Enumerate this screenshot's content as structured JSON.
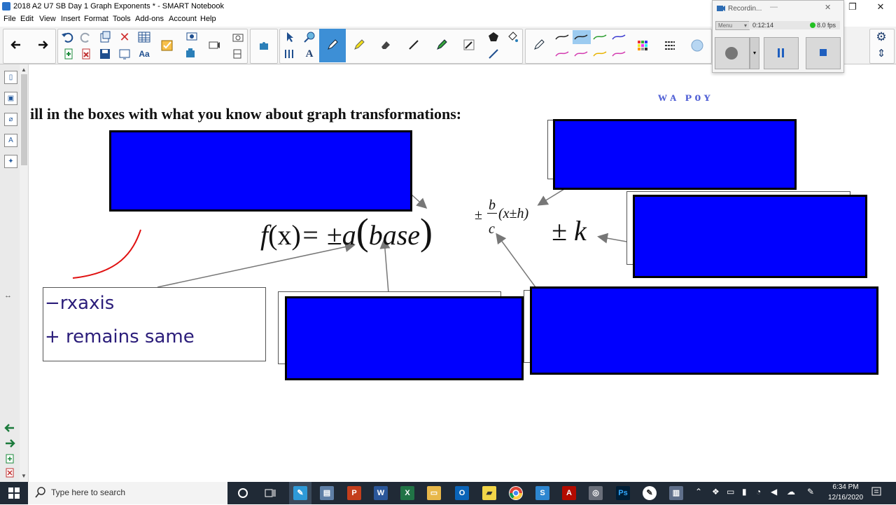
{
  "window": {
    "title": "2018 A2 U7 SB Day 1 Graph Exponents * - SMART Notebook",
    "minimize_glyph": "—",
    "restore_glyph": "❐",
    "close_glyph": "✕"
  },
  "menu": [
    "File",
    "Edit",
    "View",
    "Insert",
    "Format",
    "Tools",
    "Add-ons",
    "Account",
    "Help"
  ],
  "toolbar": {
    "back_glyph": "🡐",
    "forward_glyph": "🡒",
    "text_tool_glyph": "A",
    "font_glyph": "Aa"
  },
  "recorder": {
    "title": "Recordin...",
    "menu_label": "Menu",
    "timer": "0:12:14",
    "fps": "8.0 fps"
  },
  "slide": {
    "instruction": "ill in the boxes with what you know about graph transformations:",
    "formula": {
      "f": "f",
      "paren_x": "(x)",
      "equals_pm_a": "= ±a",
      "lparen": "(",
      "base": "base",
      "rparen": ")",
      "exp_pm": "±",
      "exp_b": "b",
      "exp_c": "c",
      "exp_inner": "(x±h)",
      "plus_k": "± k"
    },
    "handwriting": {
      "line1": "−rxaxis",
      "line2": "+ remains same"
    },
    "faded_text_top_right": "ᴡᴀ ᴘᴏʏ"
  },
  "taskbar": {
    "search_placeholder": "Type here to search",
    "time": "6:34 PM",
    "date": "12/16/2020"
  },
  "colors": {
    "blue_box": "#0000ff",
    "arrow": "#777777",
    "red_stroke": "#e01010",
    "handwriting": "#2b1d7a"
  }
}
